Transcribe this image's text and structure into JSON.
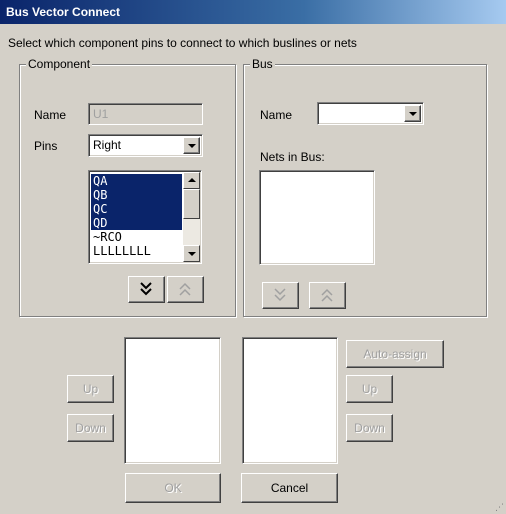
{
  "window": {
    "title": "Bus Vector Connect"
  },
  "instruction": "Select which component pins to connect to which buslines or nets",
  "component": {
    "group_label": "Component",
    "name_label": "Name",
    "name_value": "U1",
    "pins_label": "Pins",
    "pins_value": "Right",
    "pin_list": [
      {
        "label": "QA",
        "selected": true
      },
      {
        "label": "QB",
        "selected": true
      },
      {
        "label": "QC",
        "selected": true
      },
      {
        "label": "QD",
        "selected": true
      },
      {
        "label": "~RCO",
        "selected": false
      },
      {
        "label": "LLLLLLLL",
        "selected": false
      }
    ],
    "move_down_icon": "double-chevron-down-icon",
    "move_up_icon": "double-chevron-up-icon"
  },
  "bus": {
    "group_label": "Bus",
    "name_label": "Name",
    "name_value": "",
    "nets_label": "Nets in Bus:",
    "nets": [],
    "move_down_icon": "double-chevron-down-icon",
    "move_up_icon": "double-chevron-up-icon"
  },
  "lower": {
    "left_up": "Up",
    "left_down": "Down",
    "auto_assign": "Auto-assign",
    "right_up": "Up",
    "right_down": "Down"
  },
  "footer": {
    "ok": "OK",
    "cancel": "Cancel"
  },
  "colors": {
    "selection": "#0a246a",
    "face": "#d4d0c8",
    "title_start": "#0a246a",
    "title_end": "#a6caf0"
  }
}
